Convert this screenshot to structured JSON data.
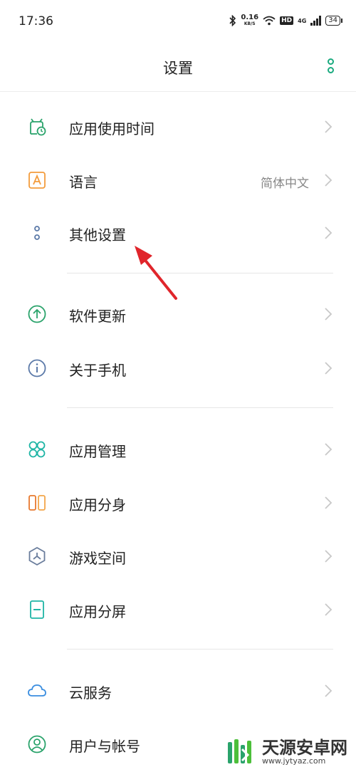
{
  "status": {
    "time": "17:36",
    "speed_value": "0.16",
    "speed_unit": "KB/S",
    "hd": "HD",
    "net": "4G",
    "battery": "34"
  },
  "header": {
    "title": "设置"
  },
  "rows": [
    {
      "label": "应用使用时间",
      "icon": "app-usage-time-icon"
    },
    {
      "label": "语言",
      "value": "简体中文",
      "icon": "language-icon"
    },
    {
      "label": "其他设置",
      "icon": "other-settings-icon"
    },
    {
      "label": "软件更新",
      "icon": "software-update-icon"
    },
    {
      "label": "关于手机",
      "icon": "about-phone-icon"
    },
    {
      "label": "应用管理",
      "icon": "app-management-icon"
    },
    {
      "label": "应用分身",
      "icon": "app-clone-icon"
    },
    {
      "label": "游戏空间",
      "icon": "game-space-icon"
    },
    {
      "label": "应用分屏",
      "icon": "split-screen-icon"
    },
    {
      "label": "云服务",
      "icon": "cloud-service-icon"
    },
    {
      "label": "用户与帐号",
      "icon": "user-account-icon"
    }
  ],
  "watermark": {
    "title": "天源安卓网",
    "url": "www.jytyaz.com"
  },
  "colors": {
    "accent": "#1aaa7f",
    "chevron": "#c8c8c8",
    "arrow": "#e0252b"
  }
}
